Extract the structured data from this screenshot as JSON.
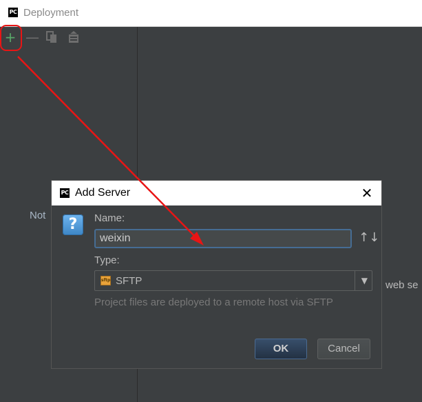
{
  "window": {
    "title": "Deployment",
    "logo": "PC"
  },
  "toolbar": {
    "add_icon": "plus-icon",
    "remove_icon": "minus-icon",
    "copy_icon": "copy-icon",
    "move_icon": "move-icon"
  },
  "left_panel": {
    "empty_text": "Not"
  },
  "right_panel": {
    "hint_text": "web se"
  },
  "dialog": {
    "logo": "PC",
    "title": "Add Server",
    "close_glyph": "✕",
    "question_glyph": "?",
    "name_label": "Name:",
    "name_value": "weixin",
    "sort_glyph": "↑↓",
    "type_label": "Type:",
    "type_value": "SFTP",
    "type_icon_text": "sftp",
    "description": "Project files are deployed to a remote host via SFTP",
    "ok_label": "OK",
    "cancel_label": "Cancel"
  },
  "annotation": {
    "color": "#e81515"
  }
}
